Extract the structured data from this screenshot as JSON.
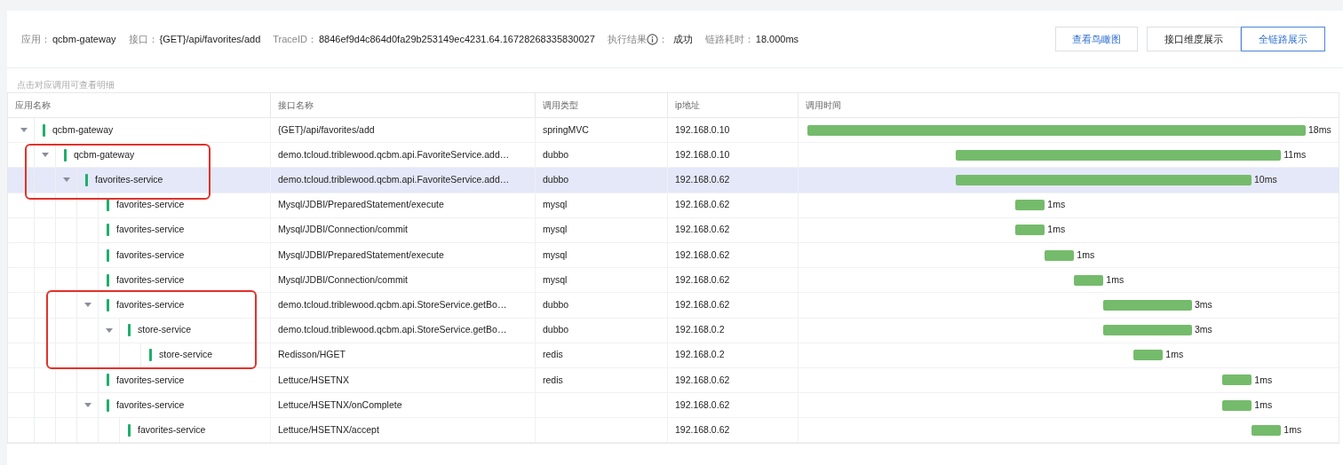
{
  "info": [
    {
      "label": "应用：",
      "value": "qcbm-gateway"
    },
    {
      "label": "接口：",
      "value": "{GET}/api/favorites/add"
    },
    {
      "label": "TraceID：",
      "value": "8846ef9d4c864d0fa29b253149ec4231.64.16728268335830027"
    },
    {
      "label": "执行结果",
      "info_icon": true,
      "suffix": "：",
      "value": "成功"
    },
    {
      "label": "链路耗时：",
      "value": "18.000ms"
    }
  ],
  "overview_button": "查看鸟瞰图",
  "view_tabs": [
    {
      "label": "接口维度展示",
      "selected": false
    },
    {
      "label": "全链路展示",
      "selected": true
    }
  ],
  "hint": "点击对应调用可查看明细",
  "columns": [
    "应用名称",
    "接口名称",
    "调用类型",
    "ip地址",
    "调用时间"
  ],
  "rows": [
    {
      "app": "qcbm-gateway",
      "interface": "{GET}/api/favorites/add",
      "type": "springMVC",
      "ip": "192.168.0.10",
      "duration": "18ms",
      "selected": false,
      "expanded": true,
      "children": [
        {
          "app": "qcbm-gateway",
          "interface": "demo.tcloud.triblewood.qcbm.api.FavoriteService.add…",
          "type": "dubbo",
          "ip": "192.168.0.10",
          "duration": "11ms",
          "selected": false,
          "expanded": true,
          "children": [
            {
              "app": "favorites-service",
              "interface": "demo.tcloud.triblewood.qcbm.api.FavoriteService.add…",
              "type": "dubbo",
              "ip": "192.168.0.62",
              "duration": "10ms",
              "selected": true,
              "expanded": true,
              "children": [
                {
                  "app": "favorites-service",
                  "interface": "Mysql/JDBI/PreparedStatement/execute",
                  "type": "mysql",
                  "ip": "192.168.0.62",
                  "duration": "1ms",
                  "selected": false
                },
                {
                  "app": "favorites-service",
                  "interface": "Mysql/JDBI/Connection/commit",
                  "type": "mysql",
                  "ip": "192.168.0.62",
                  "duration": "1ms",
                  "selected": false
                },
                {
                  "app": "favorites-service",
                  "interface": "Mysql/JDBI/PreparedStatement/execute",
                  "type": "mysql",
                  "ip": "192.168.0.62",
                  "duration": "1ms",
                  "selected": false
                },
                {
                  "app": "favorites-service",
                  "interface": "Mysql/JDBI/Connection/commit",
                  "type": "mysql",
                  "ip": "192.168.0.62",
                  "duration": "1ms",
                  "selected": false
                },
                {
                  "app": "favorites-service",
                  "interface": "demo.tcloud.triblewood.qcbm.api.StoreService.getBo…",
                  "type": "dubbo",
                  "ip": "192.168.0.62",
                  "duration": "3ms",
                  "selected": false,
                  "expanded": true,
                  "children": [
                    {
                      "app": "store-service",
                      "interface": "demo.tcloud.triblewood.qcbm.api.StoreService.getBo…",
                      "type": "dubbo",
                      "ip": "192.168.0.2",
                      "duration": "3ms",
                      "selected": false,
                      "expanded": true,
                      "children": [
                        {
                          "app": "store-service",
                          "interface": "Redisson/HGET",
                          "type": "redis",
                          "ip": "192.168.0.2",
                          "duration": "1ms",
                          "selected": false
                        }
                      ]
                    }
                  ]
                },
                {
                  "app": "favorites-service",
                  "interface": "Lettuce/HSETNX",
                  "type": "redis",
                  "ip": "192.168.0.62",
                  "duration": "1ms",
                  "selected": false
                },
                {
                  "app": "favorites-service",
                  "interface": "Lettuce/HSETNX/onComplete",
                  "ip": "192.168.0.62",
                  "duration": "1ms",
                  "selected": false,
                  "expanded": true,
                  "children": [
                    {
                      "app": "favorites-service",
                      "interface": "Lettuce/HSETNX/accept",
                      "ip": "192.168.0.62",
                      "duration": "1ms",
                      "selected": false
                    }
                  ]
                }
              ]
            }
          ]
        }
      ]
    }
  ]
}
